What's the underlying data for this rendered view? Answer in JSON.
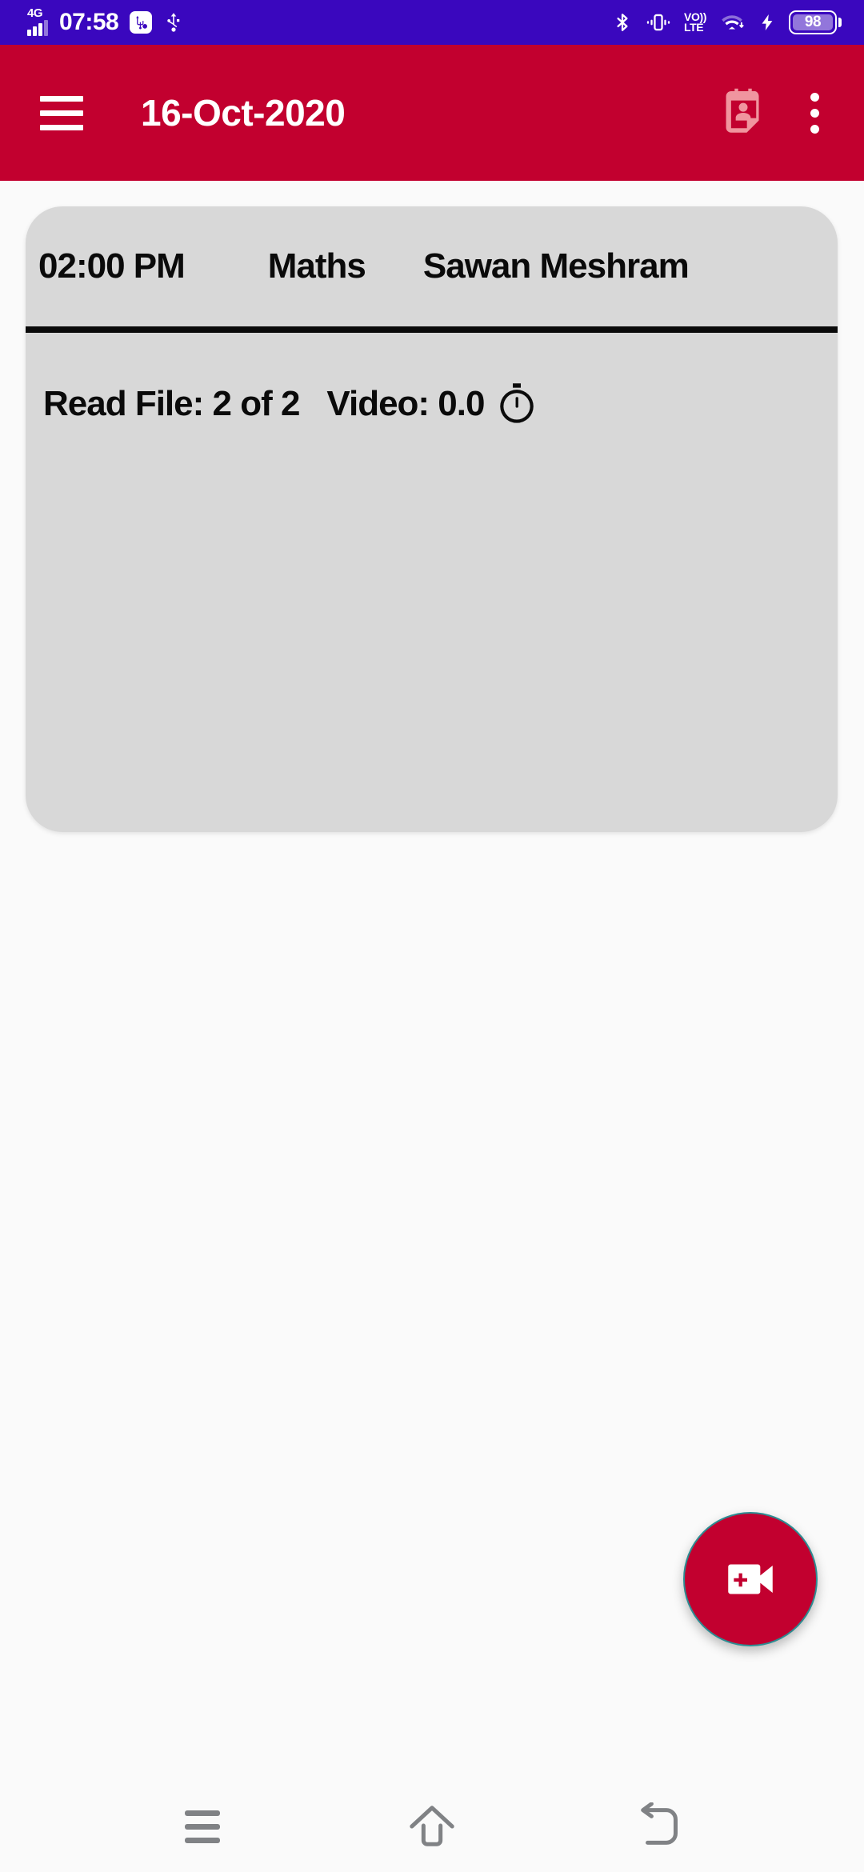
{
  "status_bar": {
    "network_type": "4G",
    "time": "07:58",
    "icons": {
      "signal": "signal-bars-icon",
      "usb_debugging": "usb-debugging-icon",
      "usb": "usb-icon",
      "bluetooth": "bluetooth-icon",
      "vibrate": "vibrate-icon",
      "volte": "volte-icon",
      "wifi": "wifi-icon",
      "charging": "charging-bolt-icon",
      "battery": "battery-icon"
    },
    "volte_top": "VO))",
    "volte_bottom": "LTE",
    "battery_level": "98",
    "background_color": "#3A07BE"
  },
  "app_bar": {
    "menu_icon": "hamburger-menu-icon",
    "title": "16-Oct-2020",
    "calendar_contact_icon": "calendar-contact-icon",
    "overflow_icon": "overflow-menu-icon",
    "background_color": "#C2002F"
  },
  "session_card": {
    "time": "02:00 PM",
    "subject": "Maths",
    "teacher": "Sawan Meshram",
    "read_file_label": "Read File: 2 of 2",
    "video_label": "Video: 0.0",
    "timer_icon": "stopwatch-icon",
    "background_color": "#D8D8D8"
  },
  "fab": {
    "icon": "video-call-add-icon",
    "label": "Start video call",
    "background_color": "#C2002F"
  },
  "nav_bar": {
    "recents_label": "Recent apps",
    "home_label": "Home",
    "back_label": "Back"
  }
}
